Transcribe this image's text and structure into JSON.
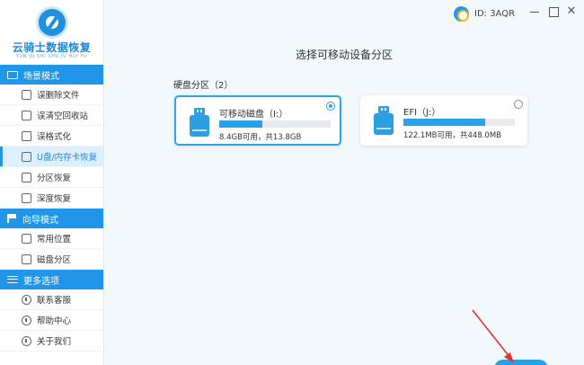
{
  "user": {
    "id_text": "ID: 3AQR"
  },
  "window": {
    "close_glyph": "✕"
  },
  "logo": {
    "name": "云骑士数据恢复",
    "pinyin": "YUN QI SHI SHU JU HUI FU"
  },
  "sidebar": {
    "sections": [
      {
        "title": "场景模式",
        "icon": "monitor-icon",
        "items": [
          {
            "label": "误删除文件",
            "icon": "file-icon"
          },
          {
            "label": "误清空回收站",
            "icon": "recycle-bin-icon"
          },
          {
            "label": "误格式化",
            "icon": "format-icon"
          },
          {
            "label": "U盘/内存卡恢复",
            "icon": "usb-drive-icon",
            "active": true
          },
          {
            "label": "分区恢复",
            "icon": "partition-icon"
          },
          {
            "label": "深度恢复",
            "icon": "deep-scan-icon"
          }
        ]
      },
      {
        "title": "向导模式",
        "icon": "flag-icon",
        "items": [
          {
            "label": "常用位置",
            "icon": "location-icon"
          },
          {
            "label": "磁盘分区",
            "icon": "disk-icon"
          }
        ]
      },
      {
        "title": "更多选项",
        "icon": "menu-icon",
        "items": [
          {
            "label": "联系客服",
            "icon": "headset-icon"
          },
          {
            "label": "帮助中心",
            "icon": "help-icon"
          },
          {
            "label": "关于我们",
            "icon": "info-icon"
          }
        ]
      }
    ]
  },
  "main": {
    "title": "选择可移动设备分区",
    "group_label": "硬盘分区（2）",
    "partitions": [
      {
        "name": "可移动磁盘（I:）",
        "usage": "8.4GB可用，共13.8GB",
        "used_fraction": 0.39,
        "selected": true
      },
      {
        "name": "EFI（J:）",
        "usage": "122.1MB可用，共448.0MB",
        "used_fraction": 0.73,
        "selected": false
      }
    ]
  },
  "colors": {
    "accent": "#2196e8",
    "bar_fill": "#27a1ea",
    "annotation_arrow": "#e0342e"
  }
}
